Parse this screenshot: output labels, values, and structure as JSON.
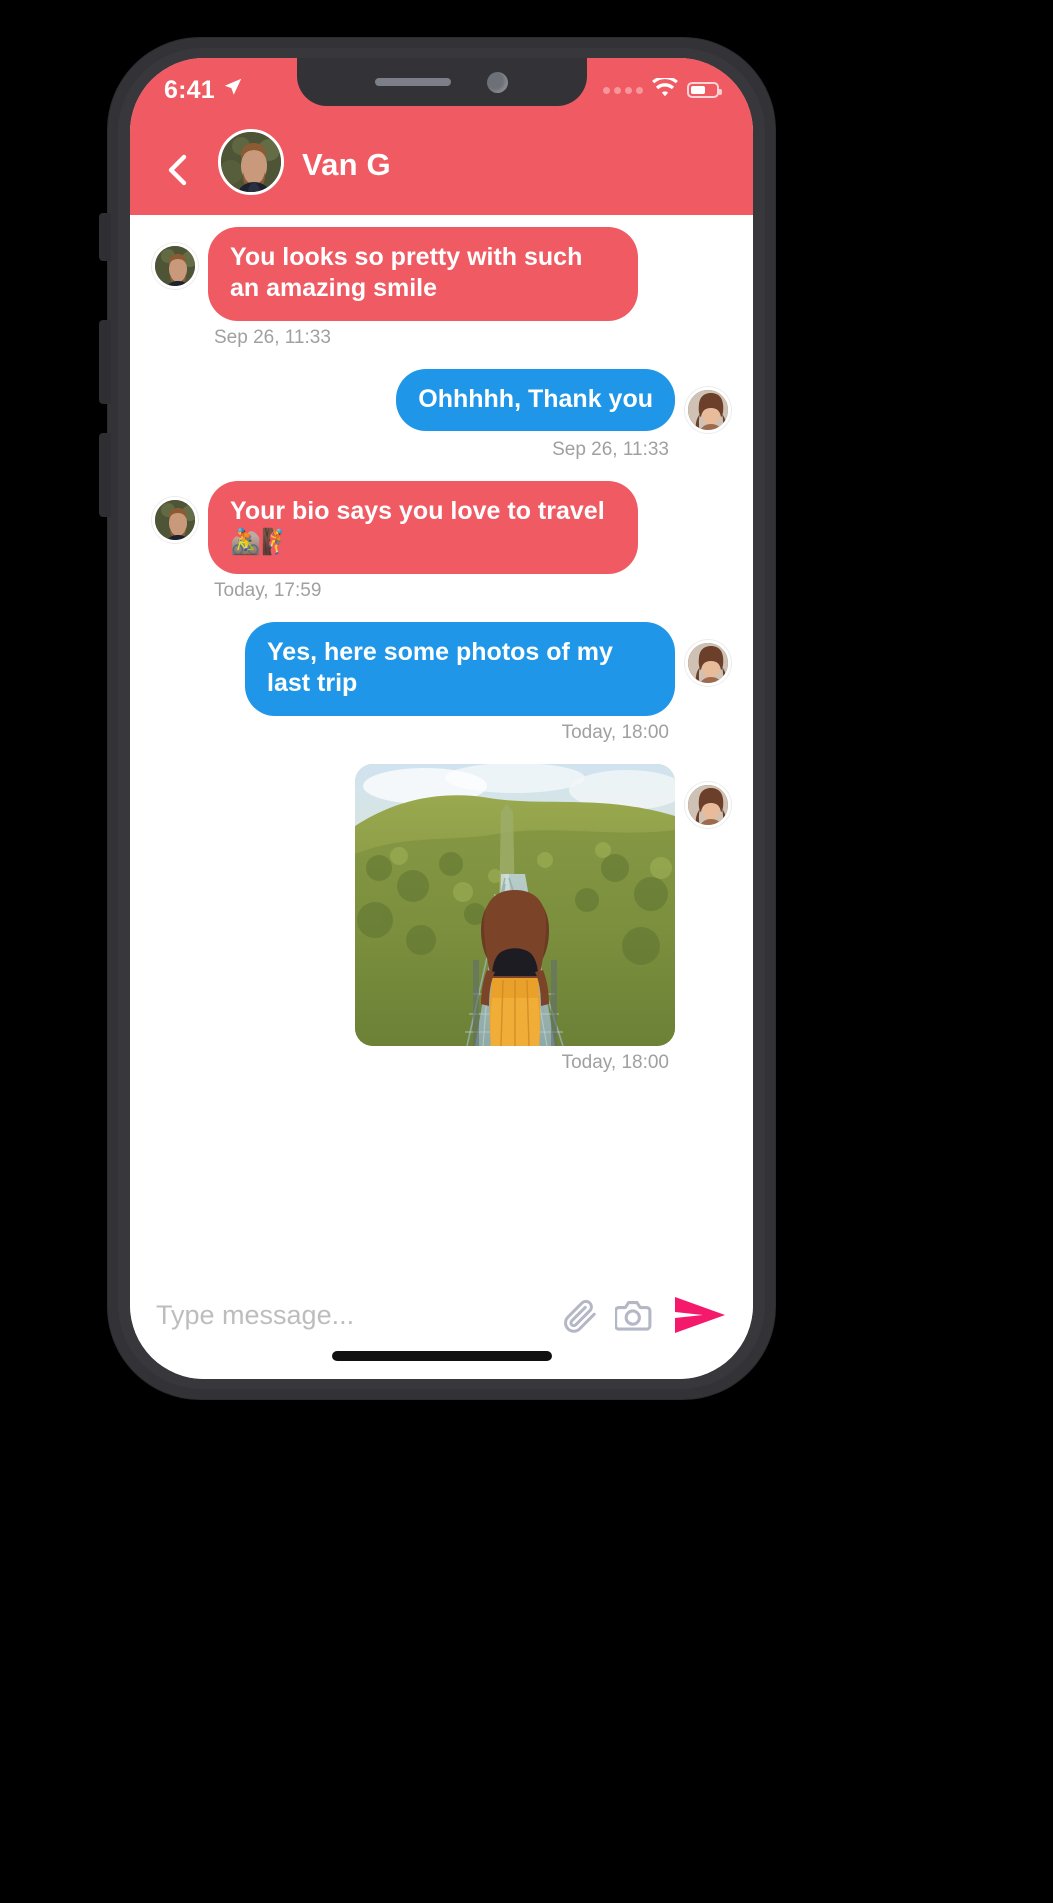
{
  "device": {
    "status_bar": {
      "time": "6:41",
      "location_icon": "location-arrow-icon",
      "signal_icon": "signal-dots-icon",
      "wifi_icon": "wifi-icon",
      "battery_icon": "battery-icon",
      "battery_level_pct": 58
    }
  },
  "header": {
    "back_icon": "chevron-left-icon",
    "avatar_name": "van-g-avatar",
    "title": "Van G",
    "accent_color": "#ef5a63"
  },
  "colors": {
    "incoming_bubble": "#ef5a63",
    "outgoing_bubble": "#1f96e8",
    "send_button": "#f5196b",
    "timestamp_text": "#a0a0a0"
  },
  "messages": [
    {
      "id": 1,
      "direction": "in",
      "type": "text",
      "text": "You looks so pretty with such an amazing smile",
      "timestamp": "Sep 26, 11:33"
    },
    {
      "id": 2,
      "direction": "out",
      "type": "text",
      "text": "Ohhhhh, Thank you",
      "timestamp": "Sep 26, 11:33"
    },
    {
      "id": 3,
      "direction": "in",
      "type": "text",
      "text": "Your bio says you love to travel🚵🧗",
      "timestamp": "Today, 17:59"
    },
    {
      "id": 4,
      "direction": "out",
      "type": "text",
      "text": "Yes, here some photos of my last trip",
      "timestamp": "Today, 18:00"
    },
    {
      "id": 5,
      "direction": "out",
      "type": "photo",
      "alt": "woman on suspension bridge over forested hills",
      "timestamp": "Today, 18:00"
    }
  ],
  "composer": {
    "placeholder": "Type message...",
    "value": "",
    "attach_icon": "paperclip-icon",
    "camera_icon": "camera-icon",
    "send_icon": "send-arrow-icon"
  }
}
